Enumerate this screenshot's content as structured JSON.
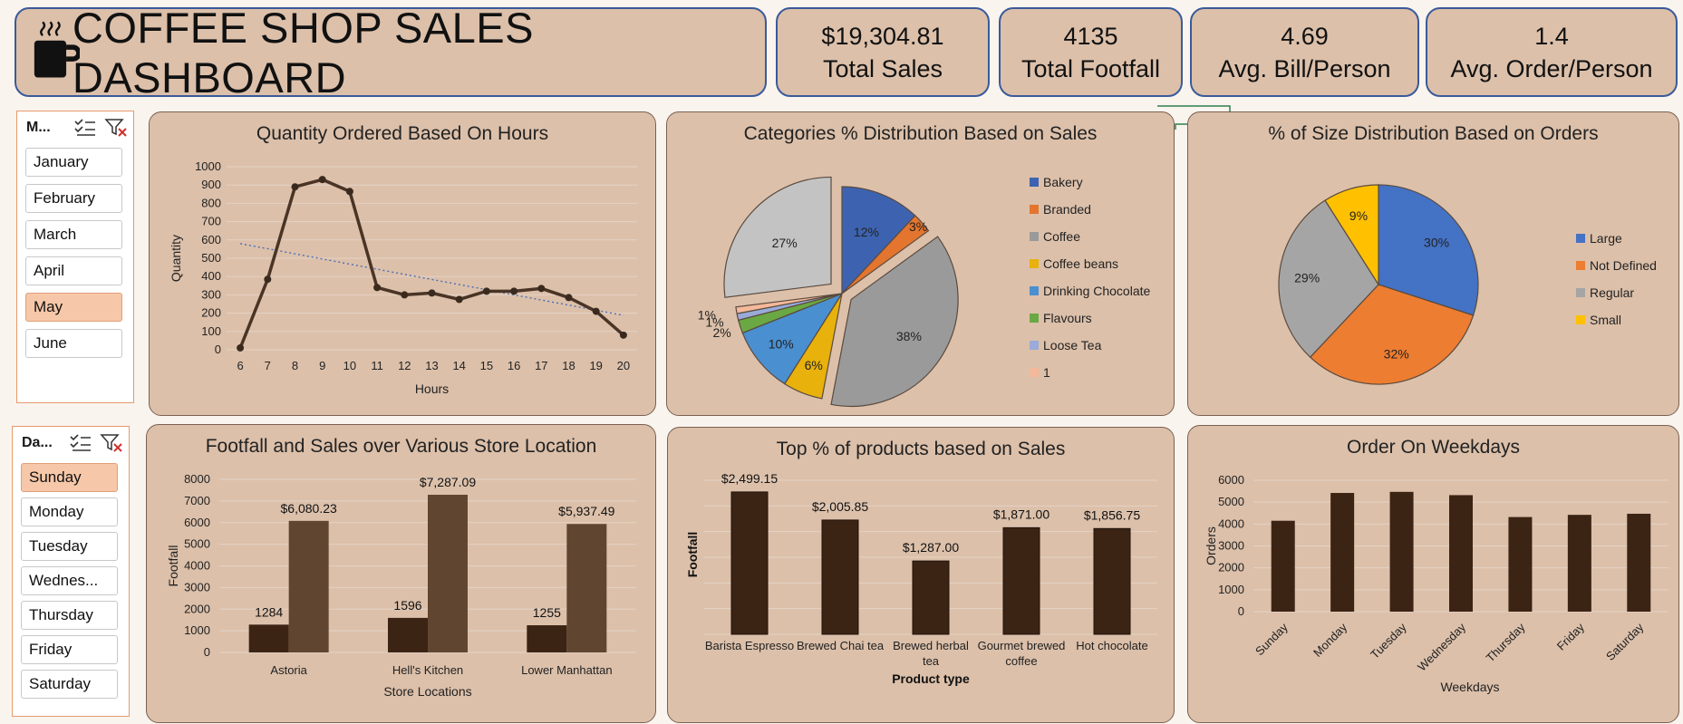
{
  "dashboard": {
    "title": "COFFEE SHOP SALES DASHBOARD",
    "icon": "coffee-cup-icon"
  },
  "kpis": [
    {
      "value": "$19,304.81",
      "label": "Total Sales"
    },
    {
      "value": "4135",
      "label": "Total Footfall"
    },
    {
      "value": "4.69",
      "label": "Avg. Bill/Person"
    },
    {
      "value": "1.4",
      "label": "Avg. Order/Person"
    }
  ],
  "month_slicer": {
    "header": "M...",
    "items": [
      "January",
      "February",
      "March",
      "April",
      "May",
      "June"
    ],
    "selected": "May"
  },
  "day_slicer": {
    "header": "Da...",
    "items": [
      "Sunday",
      "Monday",
      "Tuesday",
      "Wednes...",
      "Thursday",
      "Friday",
      "Saturday"
    ],
    "selected": "Sunday"
  },
  "colors": {
    "panel_bg": "#dcc0aa",
    "dark_brown": "#3b2414",
    "mid_brown": "#604630",
    "line": "#4a3426"
  },
  "chart_data": [
    {
      "id": "hours",
      "type": "line",
      "title": "Quantity Ordered Based On Hours",
      "xlabel": "Hours",
      "ylabel": "Quantity",
      "x": [
        6,
        7,
        8,
        9,
        10,
        11,
        12,
        13,
        14,
        15,
        16,
        17,
        18,
        19,
        20
      ],
      "values": [
        10,
        385,
        890,
        930,
        865,
        340,
        300,
        310,
        275,
        320,
        320,
        335,
        285,
        210,
        80
      ],
      "ylim": [
        0,
        1000
      ],
      "yticks": [
        0,
        100,
        200,
        300,
        400,
        500,
        600,
        700,
        800,
        900,
        1000
      ],
      "trendline": [
        580,
        188
      ]
    },
    {
      "id": "categories",
      "type": "pie",
      "title": "Categories % Distribution  Based on Sales",
      "labels": [
        "Bakery",
        "Branded",
        "Coffee",
        "Coffee beans",
        "Drinking Chocolate",
        "Flavours",
        "Loose Tea",
        "1"
      ],
      "values": [
        12,
        3,
        38,
        6,
        10,
        2,
        1,
        1,
        27
      ],
      "value_labels": [
        "12%",
        "3%",
        "38%",
        "6%",
        "10%",
        "2%",
        "1%",
        "1%",
        "27%"
      ],
      "colors": [
        "#3d63b0",
        "#e3752f",
        "#9a9a9a",
        "#e8b10b",
        "#4a8fd0",
        "#6aa843",
        "#9aabd9",
        "#f4b89a",
        "#c3c3c3"
      ],
      "legend": "right"
    },
    {
      "id": "sizes",
      "type": "pie",
      "title": "% of Size Distribution Based on Orders",
      "labels": [
        "Large",
        "Not Defined",
        "Regular",
        "Small"
      ],
      "values": [
        30,
        32,
        29,
        9
      ],
      "value_labels": [
        "30%",
        "32%",
        "29%",
        "9%"
      ],
      "colors": [
        "#4472c4",
        "#ed7d31",
        "#a5a5a5",
        "#ffc000"
      ],
      "legend": "right"
    },
    {
      "id": "stores",
      "type": "bar",
      "title": "Footfall and Sales over Various Store Location",
      "xlabel": "Store Locations",
      "ylabel": "Footfall",
      "categories": [
        "Astoria",
        "Hell's Kitchen",
        "Lower Manhattan"
      ],
      "series": [
        {
          "values": [
            1284,
            1596,
            1255
          ],
          "labels": [
            "1284",
            "1596",
            "1255"
          ]
        },
        {
          "values": [
            6080.23,
            7287.09,
            5937.49
          ],
          "labels": [
            "$6,080.23",
            "$7,287.09",
            "$5,937.49"
          ]
        }
      ],
      "ylim": [
        0,
        8000
      ],
      "yticks": [
        0,
        1000,
        2000,
        3000,
        4000,
        5000,
        6000,
        7000,
        8000
      ]
    },
    {
      "id": "products",
      "type": "bar",
      "title": "Top % of products based on Sales",
      "xlabel": "Product type",
      "ylabel": "Footfall",
      "categories": [
        "Barista Espresso",
        "Brewed Chai tea",
        "Brewed herbal tea",
        "Gourmet brewed coffee",
        "Hot chocolate"
      ],
      "values": [
        2499.15,
        2005.85,
        1287.0,
        1871.0,
        1856.75
      ],
      "value_labels": [
        "$2,499.15",
        "$2,005.85",
        "$1,287.00",
        "$1,871.00",
        "$1,856.75"
      ],
      "ylim": [
        0,
        2800
      ]
    },
    {
      "id": "weekdays",
      "type": "bar",
      "title": "Order On Weekdays",
      "xlabel": "Weekdays",
      "ylabel": "Orders",
      "categories": [
        "Sunday",
        "Monday",
        "Tuesday",
        "Wednesday",
        "Thursday",
        "Friday",
        "Saturday"
      ],
      "values": [
        4150,
        5420,
        5470,
        5320,
        4320,
        4420,
        4470
      ],
      "ylim": [
        0,
        6000
      ],
      "yticks": [
        0,
        1000,
        2000,
        3000,
        4000,
        5000,
        6000
      ]
    }
  ]
}
